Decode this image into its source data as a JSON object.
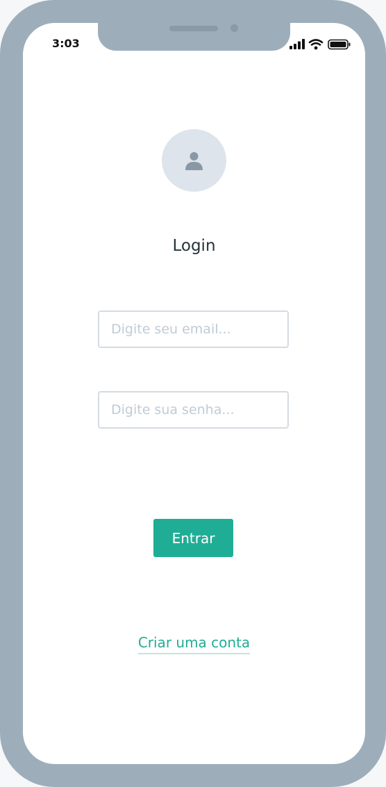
{
  "status_bar": {
    "time": "3:03",
    "icons": [
      "cellular-signal-icon",
      "wifi-icon",
      "battery-icon"
    ]
  },
  "avatar": {
    "icon": "user-icon"
  },
  "login": {
    "title": "Login",
    "email_placeholder": "Digite seu email...",
    "password_placeholder": "Digite sua senha...",
    "submit_label": "Entrar",
    "create_account_label": "Criar uma conta"
  },
  "colors": {
    "frame": "#9daeba",
    "accent": "#20ad96",
    "avatar_bg": "#dde4ec",
    "field_border": "#d4dbe2",
    "placeholder": "#c0cbd5",
    "title_text": "#263238"
  }
}
